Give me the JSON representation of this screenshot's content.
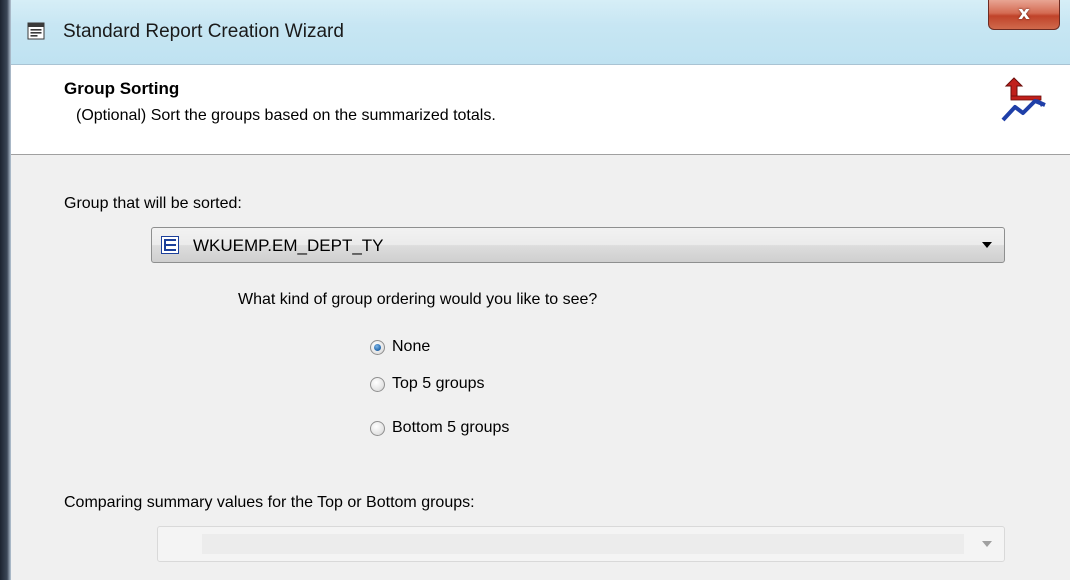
{
  "window": {
    "title": "Standard Report Creation Wizard",
    "close_label": "x"
  },
  "header": {
    "title": "Group Sorting",
    "subtitle": "(Optional) Sort the groups based on the summarized totals."
  },
  "group_select": {
    "label": "Group that will be sorted:",
    "value": "WKUEMP.EM_DEPT_TY"
  },
  "ordering": {
    "question": "What kind of group ordering would you like to see?",
    "options": [
      {
        "label": "None",
        "checked": true
      },
      {
        "label": "Top 5 groups",
        "checked": false
      },
      {
        "label": "Bottom 5 groups",
        "checked": false
      }
    ]
  },
  "summary_select": {
    "label": "Comparing summary values for the Top or Bottom groups:",
    "value": ""
  }
}
